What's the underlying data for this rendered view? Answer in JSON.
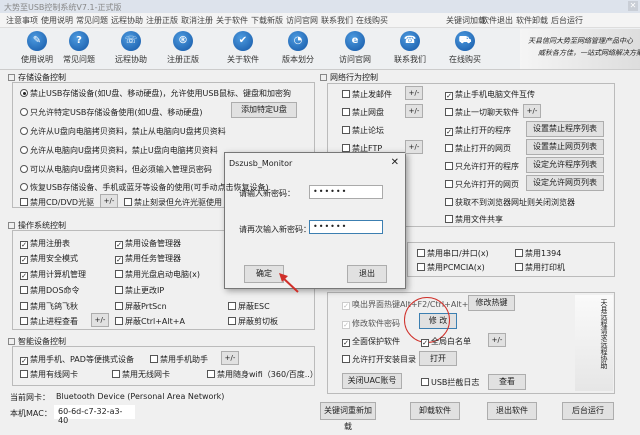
{
  "title": "大势至USB控制系统V7.1-正式版",
  "menu_left": [
    "注意事项",
    "使用说明",
    "常见问题",
    "远程协助",
    "注册正版",
    "取消注册",
    "关于软件",
    "下载新版",
    "访问官网",
    "联系我们",
    "在线购买"
  ],
  "menu_right": [
    "关键词加载",
    "软件退出",
    "软件卸载",
    "后台运行"
  ],
  "toolbar": [
    {
      "label": "使用说明",
      "icon": "book-icon",
      "glyph": "✎"
    },
    {
      "label": "常见问题",
      "icon": "question-icon",
      "glyph": "?"
    },
    {
      "label": "远程协助",
      "icon": "remote-icon",
      "glyph": "☏"
    },
    {
      "label": "注册正版",
      "icon": "registered-icon",
      "glyph": "®"
    },
    {
      "label": "关于软件",
      "icon": "about-icon",
      "glyph": "✔"
    },
    {
      "label": "版本划分",
      "icon": "version-icon",
      "glyph": "◔"
    },
    {
      "label": "访问官网",
      "icon": "ie-icon",
      "glyph": "e"
    },
    {
      "label": "联系我们",
      "icon": "contact-icon",
      "glyph": "☎"
    },
    {
      "label": "在线购买",
      "icon": "cart-icon",
      "glyph": "⛟"
    }
  ],
  "banner": [
    "天县信同大势至网络管理产品中心",
    "威秋各方佳，一站式网络解决方案！"
  ],
  "storage": {
    "title": "存储设备控制",
    "radios": [
      {
        "label": "禁止USB存储设备(如U盘、移动硬盘)，允许使用USB鼠标、键盘和加密狗",
        "checked": true
      },
      {
        "label": "只允许特定USB存储设备使用(如U盘、移动硬盘)",
        "checked": false
      },
      {
        "label": "允许从U盘向电脑拷贝资料，禁止从电脑向U盘拷贝资料",
        "checked": false
      },
      {
        "label": "允许从电脑向U盘拷贝资料，禁止U盘向电脑拷贝资料",
        "checked": false
      },
      {
        "label": "可以从电脑向U盘拷贝资料，但必须输入管理员密码",
        "checked": false
      },
      {
        "label": "恢复USB存储设备、手机或蓝牙等设备的使用(可手动点击恢复设备)",
        "checked": false
      }
    ],
    "add_button": "添加特定U盘",
    "cd_label": "禁用CD/DVD光驱",
    "pm": "+/-",
    "burn_label": "禁止刻录但允许光驱使用"
  },
  "os": {
    "title": "操作系统控制",
    "items": [
      {
        "label": "禁用注册表",
        "checked": true
      },
      {
        "label": "禁用设备管理器",
        "checked": true
      },
      {
        "label": "禁用安全模式",
        "checked": true
      },
      {
        "label": "禁用任务管理器",
        "checked": true
      },
      {
        "label": "禁用计算机管理",
        "checked": true
      },
      {
        "label": "禁用光盘启动电脑(x)",
        "checked": false
      },
      {
        "label": "禁用DOS命令",
        "checked": false
      },
      {
        "label": "禁止更改IP",
        "checked": false
      },
      {
        "label": "禁用飞鸽飞秋",
        "checked": false
      },
      {
        "label": "屏蔽PrtScn",
        "checked": false
      },
      {
        "label": "屏蔽ESC",
        "checked": false
      },
      {
        "label": "禁止进程查看",
        "checked": false
      },
      {
        "label": "屏蔽Ctrl+Alt+A",
        "checked": false
      },
      {
        "label": "屏蔽剪切板",
        "checked": false
      }
    ]
  },
  "smart": {
    "title": "智能设备控制",
    "items": [
      {
        "label": "禁用手机、PAD等便携式设备",
        "checked": true
      },
      {
        "label": "禁用手机助手",
        "checked": false
      },
      {
        "label": "禁用有线网卡",
        "checked": false
      },
      {
        "label": "禁用无线网卡",
        "checked": false
      },
      {
        "label": "禁用随身wifi（360/百度..）",
        "checked": false
      }
    ]
  },
  "nic": {
    "label": "当前网卡：",
    "value": "Bluetooth Device (Personal Area Network)",
    "mac_label": "本机MAC：",
    "mac": "60-6d-c7-32-a3-40"
  },
  "network": {
    "title": "网络行为控制",
    "left": [
      {
        "label": "禁止发邮件",
        "checked": false
      },
      {
        "label": "禁止网盘",
        "checked": false
      },
      {
        "label": "禁止论坛",
        "checked": false
      },
      {
        "label": "禁止FTP",
        "checked": false
      }
    ],
    "right": [
      {
        "label": "禁止手机电脑文件互传",
        "checked": true
      },
      {
        "label": "禁止一切聊天软件",
        "checked": false
      },
      {
        "label": "禁止打开的程序",
        "checked": true
      },
      {
        "label": "禁止打开的网页",
        "checked": false
      },
      {
        "label": "只允许打开的程序",
        "checked": false
      },
      {
        "label": "只允许打开的网页",
        "checked": false
      },
      {
        "label": "获取不到浏览器网址则关闭浏览器",
        "checked": false
      },
      {
        "label": "禁用文件共享",
        "checked": false
      }
    ],
    "buttons": [
      "设置禁止程序列表",
      "设置禁止网页列表",
      "设定允许程序列表",
      "设定允许网页列表"
    ]
  },
  "ports": [
    {
      "label": "禁用串口/并口(x)",
      "checked": false
    },
    {
      "label": "禁用1394",
      "checked": false
    },
    {
      "label": "禁用PCMCIA(x)",
      "checked": false
    },
    {
      "label": "禁用打印机",
      "checked": false
    }
  ],
  "settings": {
    "hotkey": "唤出界面热键Alt+F2/Ctrl+Alt+2",
    "hotkey_btn": "修改热键",
    "pwd": "修改软件密码",
    "pwd_btn": "修 改",
    "protect": "全面保护软件",
    "whitelist": "全局白名单",
    "allow_dir": "允许打开安装目录",
    "open_btn": "打开",
    "uac_btn": "关闭UAC账号",
    "usb_log": "USB拦截日志",
    "view_btn": "查看",
    "banner": "天县远程请求远程协助"
  },
  "bottom": [
    "关键词重新加载",
    "卸载软件",
    "退出软件",
    "后台运行"
  ],
  "dialog": {
    "title": "Dszusb_Monitor",
    "label1": "请输入新密码：",
    "value1": "••••••",
    "label2": "请再次输入新密码：",
    "value2": "••••••",
    "ok": "确定",
    "cancel": "退出"
  },
  "colors": {
    "accent": "#1456a5",
    "annotation": "#d0302a"
  }
}
